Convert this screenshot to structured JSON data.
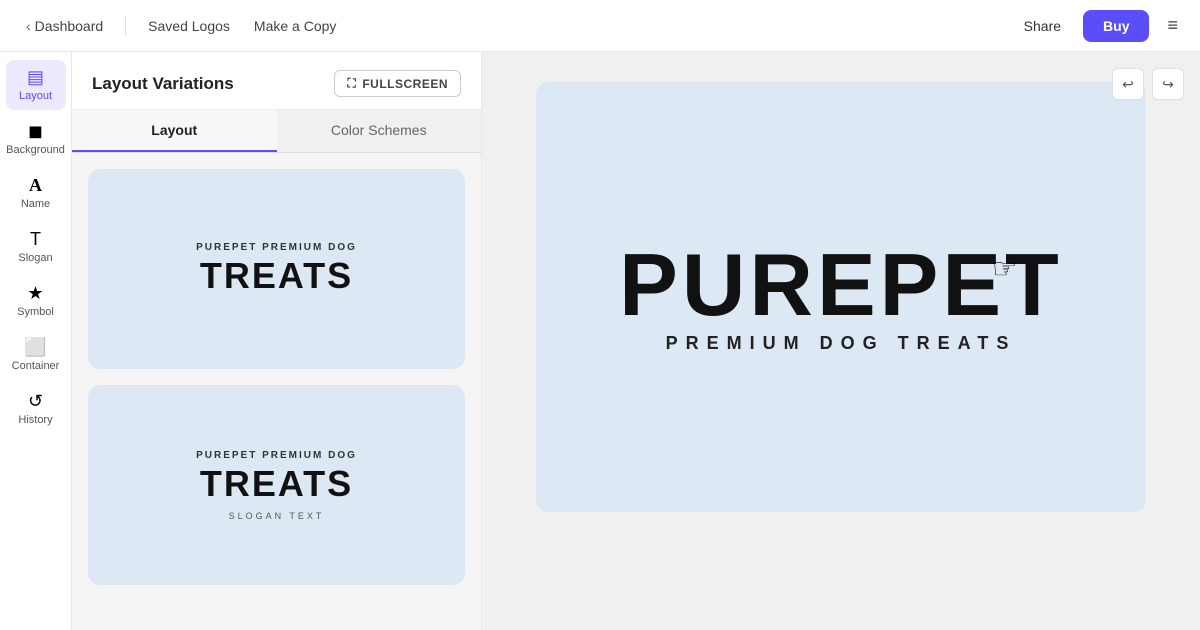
{
  "topbar": {
    "back_label": "Dashboard",
    "saved_logos_label": "Saved Logos",
    "make_copy_label": "Make a Copy",
    "share_label": "Share",
    "buy_label": "Buy"
  },
  "sidebar": {
    "items": [
      {
        "id": "layout",
        "label": "Layout",
        "icon": "▤",
        "active": true
      },
      {
        "id": "background",
        "label": "Background",
        "icon": "◼"
      },
      {
        "id": "name",
        "label": "Name",
        "icon": "A"
      },
      {
        "id": "slogan",
        "label": "Slogan",
        "icon": "T"
      },
      {
        "id": "symbol",
        "label": "Symbol",
        "icon": "★"
      },
      {
        "id": "container",
        "label": "Container",
        "icon": "⬜"
      },
      {
        "id": "history",
        "label": "History",
        "icon": "↺"
      }
    ]
  },
  "panel": {
    "title": "Layout Variations",
    "fullscreen_label": "FULLSCREEN",
    "tabs": [
      {
        "id": "layout",
        "label": "Layout",
        "active": true
      },
      {
        "id": "color_schemes",
        "label": "Color Schemes"
      }
    ],
    "cards": [
      {
        "id": "card1",
        "small_text": "PUREPET PREMIUM DOG",
        "big_text": "TREATS",
        "slogan": ""
      },
      {
        "id": "card2",
        "small_text": "PUREPET PREMIUM DOG",
        "big_text": "TREATS",
        "slogan": "SLOGAN TEXT"
      }
    ]
  },
  "canvas": {
    "main_text": "PUREPET",
    "sub_text": "PREMIUM DOG TREATS",
    "undo_label": "↩",
    "redo_label": "↪"
  }
}
